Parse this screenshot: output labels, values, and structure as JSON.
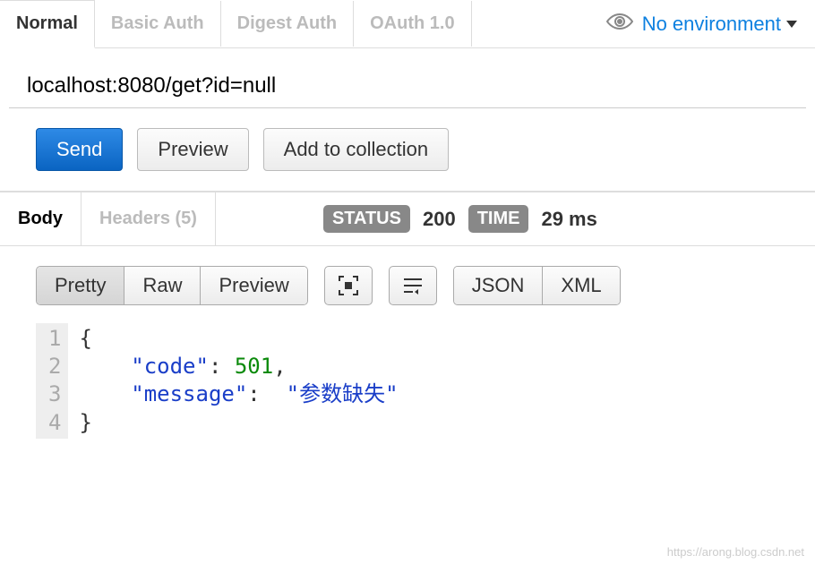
{
  "auth_tabs": [
    "Normal",
    "Basic Auth",
    "Digest Auth",
    "OAuth 1.0"
  ],
  "auth_active": 0,
  "environment_label": "No environment",
  "url": "localhost:8080/get?id=null",
  "actions": {
    "send": "Send",
    "preview": "Preview",
    "add": "Add to collection"
  },
  "response_tabs": {
    "body": "Body",
    "headers": "Headers (5)"
  },
  "status": {
    "label": "STATUS",
    "value": "200"
  },
  "time": {
    "label": "TIME",
    "value": "29 ms"
  },
  "view_modes": [
    "Pretty",
    "Raw",
    "Preview"
  ],
  "view_active": 0,
  "format_modes": [
    "JSON",
    "XML"
  ],
  "format_active": 0,
  "code": {
    "lines": [
      "1",
      "2",
      "3",
      "4"
    ],
    "body": {
      "code": 501,
      "message": "参数缺失"
    }
  },
  "watermark": "https://arong.blog.csdn.net"
}
